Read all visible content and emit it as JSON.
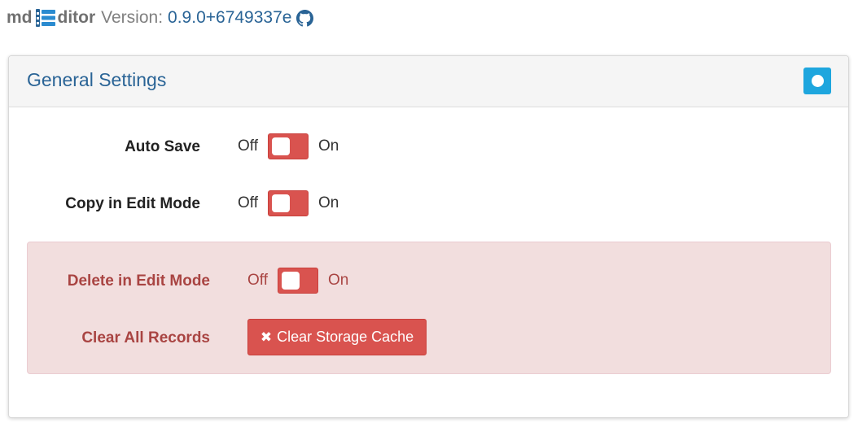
{
  "header": {
    "brand_prefix": "md",
    "brand_suffix": "ditor",
    "brand_icon": "list-icon",
    "version_label": "Version:",
    "version_value": "0.9.0+6749337e",
    "github_icon": "github-icon"
  },
  "panel": {
    "title": "General Settings",
    "heading_button_icon": "circle-icon",
    "settings": [
      {
        "label": "Auto Save",
        "off": "Off",
        "on": "On",
        "state": "off"
      },
      {
        "label": "Copy in Edit Mode",
        "off": "Off",
        "on": "On",
        "state": "off"
      }
    ],
    "danger": {
      "delete_label": "Delete in Edit Mode",
      "delete_off": "Off",
      "delete_on": "On",
      "delete_state": "off",
      "clear_label": "Clear All Records",
      "clear_button": "Clear Storage Cache",
      "clear_button_icon": "times-icon"
    }
  },
  "colors": {
    "primary": "#2a6496",
    "danger": "#d9534f",
    "danger_text": "#a94442",
    "danger_bg": "#f2dede",
    "info": "#1ea6de"
  }
}
